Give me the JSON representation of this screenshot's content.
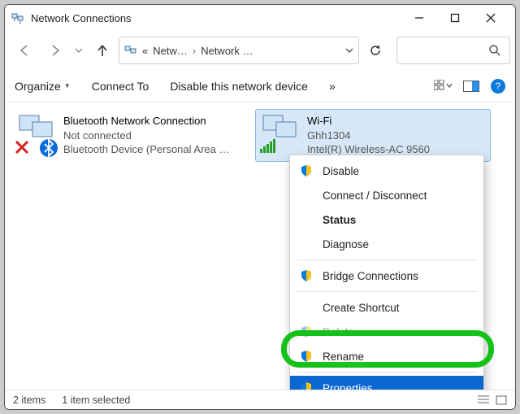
{
  "titlebar": {
    "title": "Network Connections"
  },
  "nav": {
    "crumb_prefix": "«",
    "crumb1": "Netw…",
    "crumb2": "Network …"
  },
  "toolbar": {
    "organize": "Organize",
    "connect": "Connect To",
    "disable": "Disable this network device",
    "overflow": "»"
  },
  "items": {
    "bt": {
      "name": "Bluetooth Network Connection",
      "status": "Not connected",
      "device": "Bluetooth Device (Personal Area …"
    },
    "wifi": {
      "name": "Wi-Fi",
      "status": "Ghh1304",
      "device": "Intel(R) Wireless-AC 9560"
    }
  },
  "ctx": {
    "disable": "Disable",
    "connect": "Connect / Disconnect",
    "status": "Status",
    "diagnose": "Diagnose",
    "bridge": "Bridge Connections",
    "shortcut": "Create Shortcut",
    "delete": "Delete",
    "rename": "Rename",
    "properties": "Properties"
  },
  "statusbar": {
    "count": "2 items",
    "selected": "1 item selected"
  }
}
